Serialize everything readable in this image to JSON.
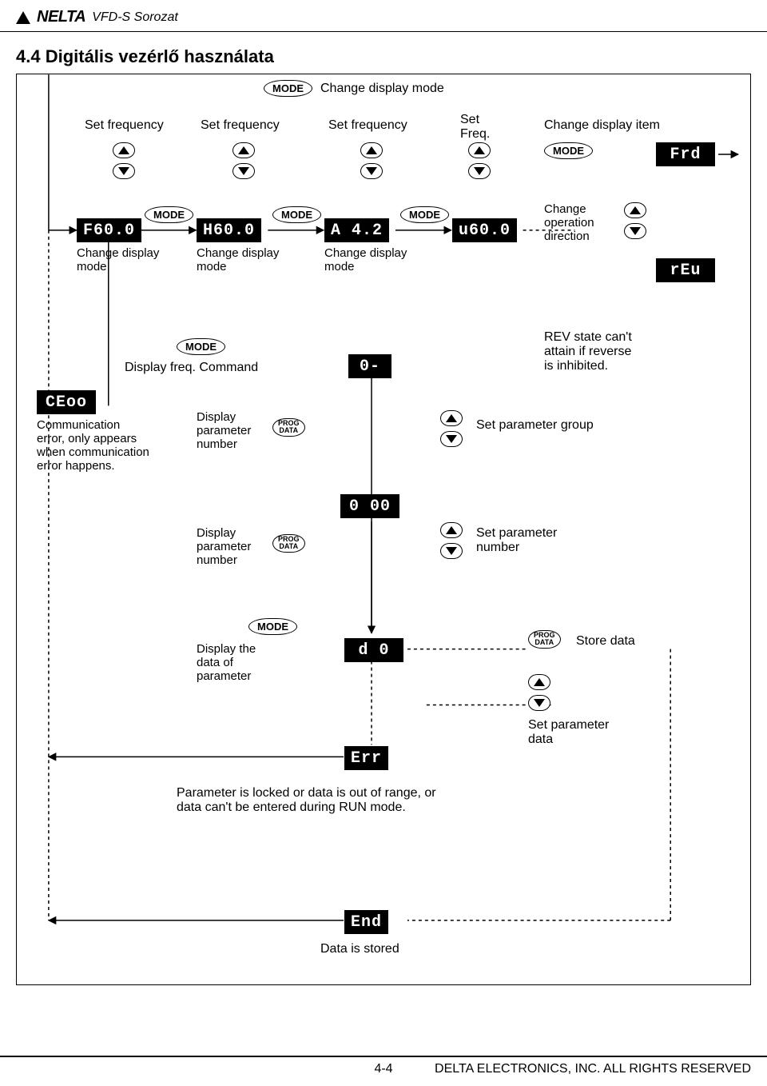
{
  "header": {
    "brand": "NELTA",
    "series": "VFD-S Sorozat"
  },
  "section_title": "4.4 Digitális vezérlő használata",
  "buttons": {
    "mode": "MODE",
    "prog_top": "PROG",
    "prog_bottom": "DATA"
  },
  "labels": {
    "change_display_mode_top": "Change display mode",
    "set_frequency": "Set frequency",
    "set_freq_short": "Set\nFreq.",
    "change_display_item": "Change display item",
    "change_display_mode": "Change display\nmode",
    "change_operation_direction": "Change\noperation\ndirection",
    "display_freq_command": "Display freq. Command",
    "rev_note": "REV state can't\nattain if reverse\nis inhibited.",
    "comm_error": "Communication\nerror, only appears\nwhen communication\nerror happens.",
    "display_param_number": "Display\nparameter\nnumber",
    "set_param_group": "Set parameter group",
    "set_param_number": "Set parameter\nnumber",
    "display_data_of_param": "Display the\ndata of\nparameter",
    "store_data": "Store data",
    "set_param_data": "Set parameter\ndata",
    "err_note": "Parameter is locked or data is out of range, or\ndata can't be entered during RUN mode.",
    "data_stored": "Data is stored"
  },
  "displays": {
    "f600": "F60.0",
    "h600": "H60.0",
    "a42": "A  4.2",
    "u600": "u60.0",
    "frd": "Frd",
    "reu": "rEu",
    "ceoo": "CEoo",
    "zero_dash": "0-",
    "zero_zero_zero": "0 00",
    "d0": "d  0",
    "err": "Err",
    "end": "End"
  },
  "footer": {
    "page": "4-4",
    "copyright": "DELTA ELECTRONICS, INC. ALL RIGHTS RESERVED"
  }
}
